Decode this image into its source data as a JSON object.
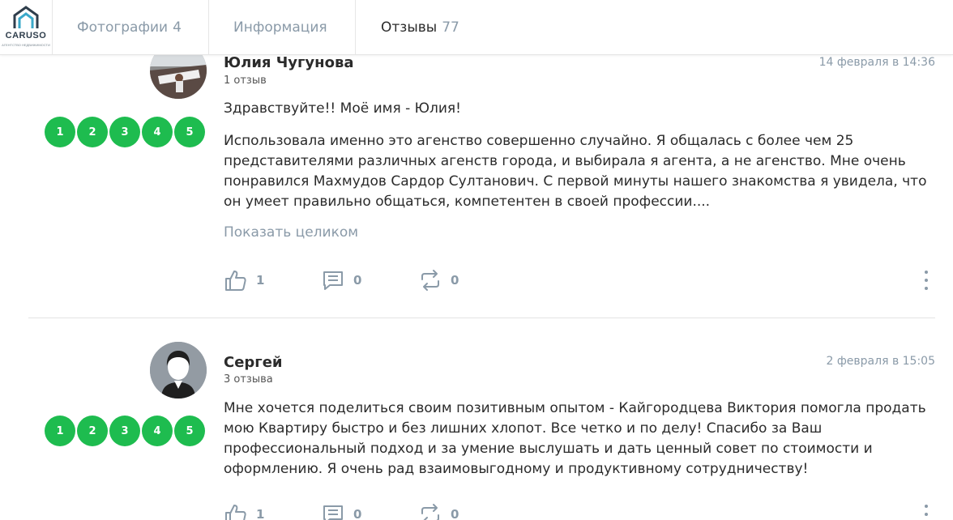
{
  "header": {
    "logo": {
      "brand": "CARUSO",
      "sub": "АГЕНТСТВО НЕДВИЖИМОСТИ"
    },
    "tabs": [
      {
        "label": "Фотографии",
        "count": "4"
      },
      {
        "label": "Информация",
        "count": ""
      },
      {
        "label": "Отзывы",
        "count": "77"
      }
    ],
    "active_tab": "Отзывы"
  },
  "reviews": [
    {
      "author": "Юлия Чугунова",
      "review_count": "1 отзыв",
      "date": "14 февраля в 14:36",
      "rating": [
        "1",
        "2",
        "3",
        "4",
        "5"
      ],
      "greeting": "Здравствуйте!! Моё имя - Юлия!",
      "text": "Использовала именно это агенство совершенно случайно. Я общалась с более чем 25 представителями различных агенств города, и выбирала я агента, а не агенство. Мне очень понравился Махмудов Сардор Султанович. С первой минуты нашего знакомства я увидела, что он умеет правильно общаться, компетентен в своей профессии....",
      "show_more": "Показать целиком",
      "likes": "1",
      "comments": "0",
      "reposts": "0"
    },
    {
      "author": "Сергей",
      "review_count": "3 отзыва",
      "date": "2 февраля в 15:05",
      "rating": [
        "1",
        "2",
        "3",
        "4",
        "5"
      ],
      "text": "Мне хочется поделиться своим позитивным опытом - Кайгородцева Виктория помогла продать мою Квартиру быстро и без лишних хлопот. Все четко и по делу! Спасибо за Ваш профессиональный подход и за умение выслушать и дать ценный совет по стоимости и оформлению. Я очень рад взаимовыгодному и продуктивному сотрудничеству!",
      "likes": "1",
      "comments": "0",
      "reposts": "0"
    }
  ],
  "colors": {
    "rating_green": "#1ebc4f",
    "muted": "#8a9aa8",
    "accent_logo": "#3aa8c9"
  }
}
